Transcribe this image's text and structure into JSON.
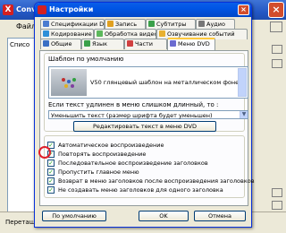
{
  "background_app": {
    "title": "Conv",
    "menu_first": "Файл",
    "list_label": "Списо",
    "status_text": "Перетащ"
  },
  "dialog": {
    "title": "Настройки",
    "tabs_row1": [
      "Спецификации DVD",
      "Запись",
      "Субтитры",
      "Аудио"
    ],
    "tabs_row2": [
      "Кодирование",
      "Обработка видео",
      "Озвучивание событий"
    ],
    "tabs_row3": [
      "Общие",
      "Язык",
      "Части",
      "Меню DVD"
    ],
    "template_label": "Шаблон по умолчанию",
    "template_value": "V50 глянцевый шаблон на металлическом фоне, до 10-и",
    "long_text_label": "Если текст удлинен в меню слишком длинный, то :",
    "long_text_option": "Уменьшить текст (размер шрифта будет уменьшен)",
    "edit_button": "Редактировать текст в меню DVD",
    "checkboxes": [
      {
        "label": "Автоматическое воспроизведение",
        "checked": true
      },
      {
        "label": "Повторять воспроизведение",
        "checked": true
      },
      {
        "label": "Последовательное воспроизведение заголовков",
        "checked": true
      },
      {
        "label": "Пропустить главное меню",
        "checked": true
      },
      {
        "label": "Возврат в меню заголовков после воспроизведения заголовков",
        "checked": true
      },
      {
        "label": "Не создавать меню заголовков для одного заголовка",
        "checked": true
      }
    ],
    "check_mark": "✓",
    "buttons": {
      "default": "По умолчанию",
      "ok": "OK",
      "cancel": "Отмена"
    },
    "highlight_color": "#e0202a"
  }
}
